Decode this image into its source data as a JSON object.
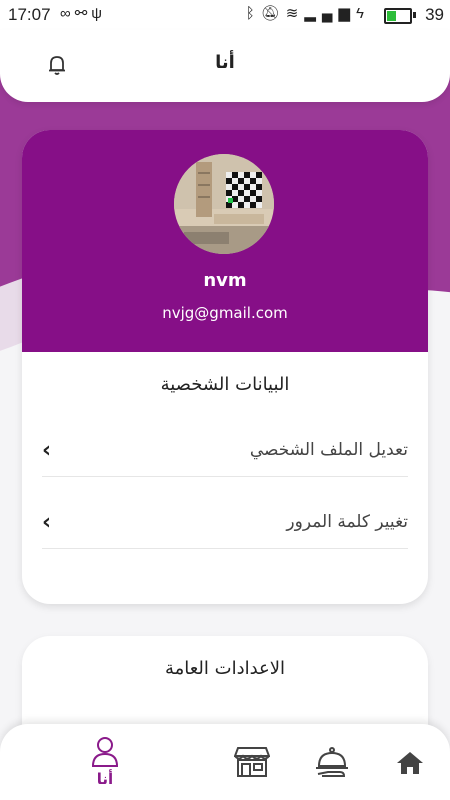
{
  "status_bar": {
    "time": "17:07",
    "battery_level": "39",
    "left_icons": [
      "infinity-icon",
      "usb-hub-icon",
      "usb-icon"
    ],
    "right_icons": [
      "bluetooth-icon",
      "mute-icon",
      "wifi-icon",
      "signal-icon",
      "charging-icon"
    ],
    "battery_fraction": 0.39
  },
  "header": {
    "title": "أنا",
    "bell_icon": "bell-icon"
  },
  "profile": {
    "name": "nvm",
    "email": "nvjg@gmail.com",
    "avatar_icon": "room-photo-avatar"
  },
  "personal_section": {
    "title": "البيانات الشخصية",
    "items": [
      {
        "label": "تعديل الملف الشخصي",
        "icon": "chevron-left-icon"
      },
      {
        "label": "تغيير كلمة المرور",
        "icon": "chevron-left-icon"
      }
    ]
  },
  "general_section": {
    "title": "الاعدادات العامة"
  },
  "bottom_nav": {
    "items": [
      {
        "label": "أنا",
        "icon": "user-icon",
        "active": true
      },
      {
        "label": "",
        "icon": "store-icon",
        "active": false
      },
      {
        "label": "",
        "icon": "food-tray-icon",
        "active": false
      },
      {
        "label": "",
        "icon": "home-icon",
        "active": false
      }
    ]
  },
  "colors": {
    "accent": "#860f87",
    "background_purple": "#9b3a97",
    "active_nav": "#8a1a8a"
  }
}
